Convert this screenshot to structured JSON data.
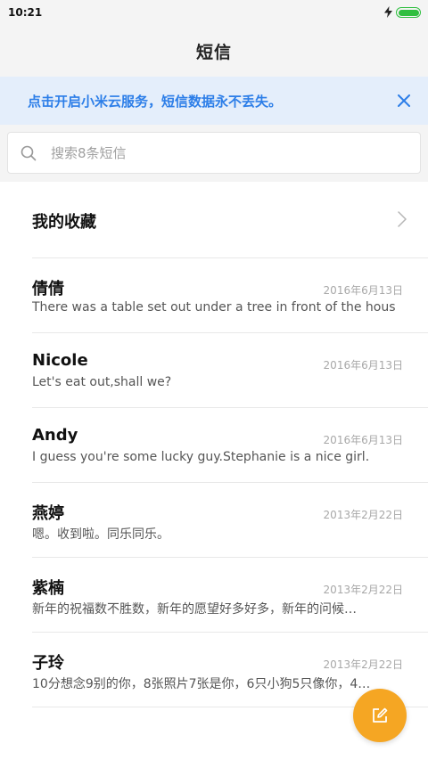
{
  "status_bar": {
    "time": "10:21",
    "battery_color": "#2fbf3f"
  },
  "header": {
    "title": "短信"
  },
  "cloud_banner": {
    "text": "点击开启小米云服务，短信数据永不丢失。",
    "close_icon": "close-icon",
    "accent_color": "#2c7ee8"
  },
  "search": {
    "placeholder": "搜索8条短信",
    "icon": "search-icon"
  },
  "favorites": {
    "label": "我的收藏",
    "icon": "chevron-right-icon"
  },
  "messages": [
    {
      "name": "倩倩",
      "date": "2016年6月13日",
      "preview": "There was a table set out under a tree in front of the hous"
    },
    {
      "name": "Nicole",
      "date": "2016年6月13日",
      "preview": "Let's eat out,shall we?"
    },
    {
      "name": "Andy",
      "date": "2016年6月13日",
      "preview": "I guess you're some lucky guy.Stephanie is a nice girl."
    },
    {
      "name": "燕婷",
      "date": "2013年2月22日",
      "preview": "嗯。收到啦。同乐同乐。"
    },
    {
      "name": "紫楠",
      "date": "2013年2月22日",
      "preview": "新年的祝福数不胜数，新年的愿望好多好多，新年的问候…"
    },
    {
      "name": "子玲",
      "date": "2013年2月22日",
      "preview": "10分想念9别的你，8张照片7张是你，6只小狗5只像你，4…"
    }
  ],
  "compose_button": {
    "icon": "compose-icon",
    "color": "#f5a623"
  }
}
